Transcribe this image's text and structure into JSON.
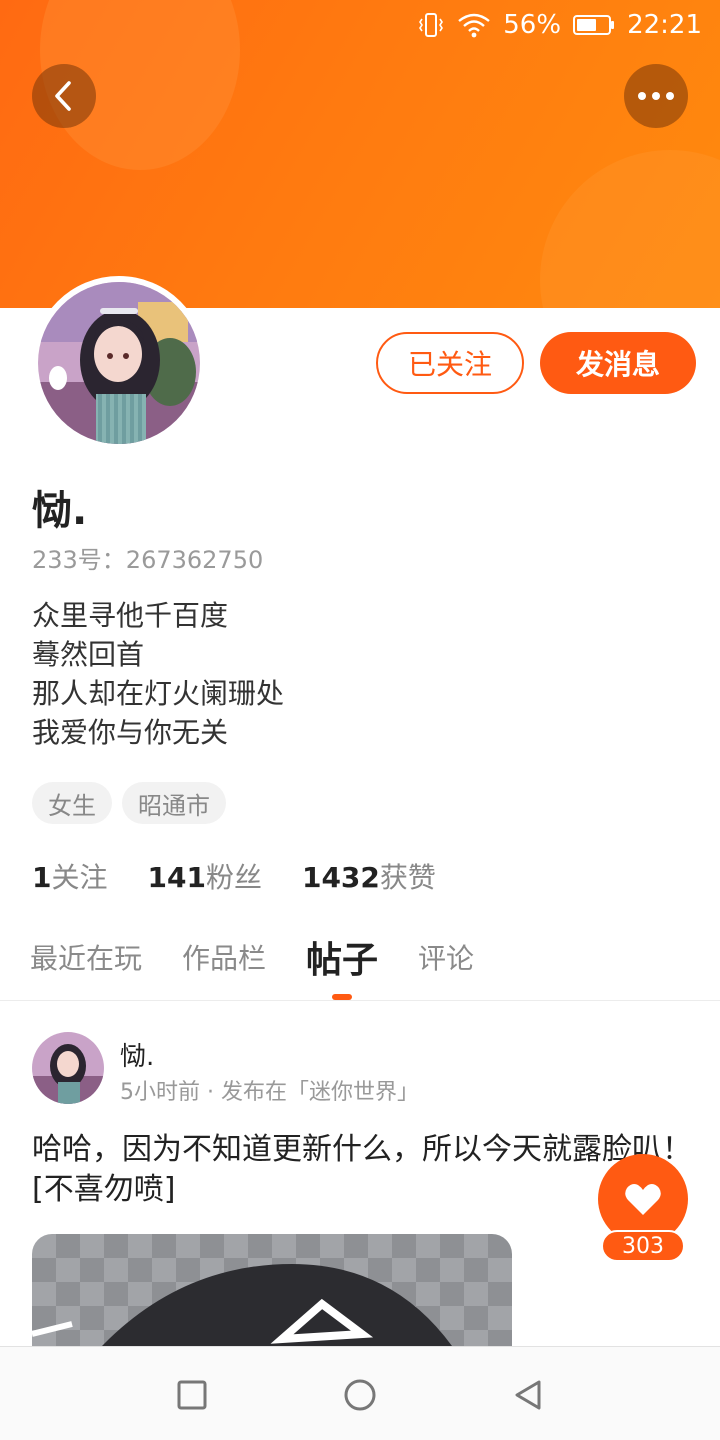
{
  "status_bar": {
    "battery_percent": "56%",
    "time": "22:21",
    "icons": [
      "vibrate-icon",
      "wifi-icon",
      "battery-icon"
    ]
  },
  "header": {
    "accent_color": "#ff6a12",
    "back_icon": "chevron-left-icon",
    "more_icon": "more-dots-icon"
  },
  "profile": {
    "follow_label": "已关注",
    "message_label": "发消息",
    "username": "恸.",
    "user_id": "233号：267362750",
    "bio": [
      "众里寻他千百度",
      "蓦然回首",
      "那人却在灯火阑珊处",
      "我爱你与你无关"
    ],
    "tags": [
      "女生",
      "昭通市"
    ],
    "stats": [
      {
        "num": "1",
        "label": "关注"
      },
      {
        "num": "141",
        "label": "粉丝"
      },
      {
        "num": "1432",
        "label": "获赞"
      }
    ]
  },
  "tabs": [
    {
      "label": "最近在玩",
      "active": false
    },
    {
      "label": "作品栏",
      "active": false
    },
    {
      "label": "帖子",
      "active": true
    },
    {
      "label": "评论",
      "active": false
    }
  ],
  "post": {
    "author": "恸.",
    "meta": "5小时前 · 发布在「迷你世界」",
    "text": "哈哈，因为不知道更新什么，所以今天就露脸叭！[不喜勿喷]",
    "like_count": "303"
  },
  "navbar": {
    "icons": [
      "recents-square-icon",
      "home-circle-icon",
      "back-triangle-icon"
    ]
  }
}
